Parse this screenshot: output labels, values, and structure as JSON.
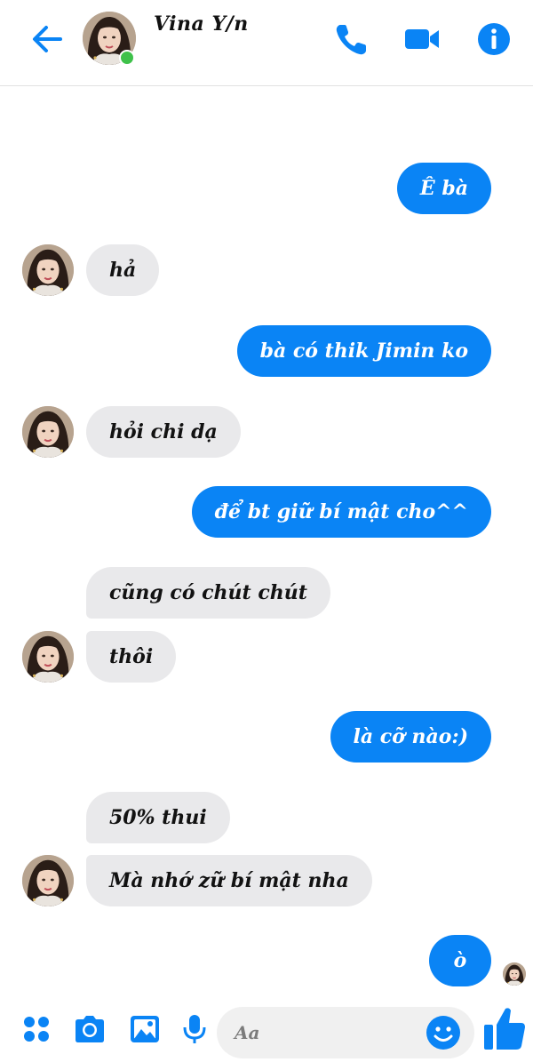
{
  "header": {
    "contact_name": "Vina Y/n",
    "online": true
  },
  "messages": [
    {
      "side": "out",
      "text": "Ê bà"
    },
    {
      "side": "in",
      "text": "hả"
    },
    {
      "side": "out",
      "text": "bà có thik Jimin ko"
    },
    {
      "side": "in",
      "text": "hỏi chi dạ"
    },
    {
      "side": "out",
      "text": "để bt giữ bí mật cho^^"
    },
    {
      "side": "in",
      "text": "cũng có chút chút"
    },
    {
      "side": "in",
      "text": "thôi"
    },
    {
      "side": "out",
      "text": "là cỡ nào:)"
    },
    {
      "side": "in",
      "text": "50% thui"
    },
    {
      "side": "in",
      "text": "Mà nhớ zữ bí mật nha"
    },
    {
      "side": "out",
      "text": "ò"
    }
  ],
  "composer": {
    "placeholder": "Aa"
  },
  "colors": {
    "accent": "#0a84f5",
    "incoming_bubble": "#e9e9eb",
    "online_dot": "#3ec14a"
  },
  "icons": [
    "back-arrow-icon",
    "phone-icon",
    "video-camera-icon",
    "info-icon",
    "apps-grid-icon",
    "camera-icon",
    "image-icon",
    "microphone-icon",
    "emoji-icon",
    "thumbs-up-icon"
  ]
}
